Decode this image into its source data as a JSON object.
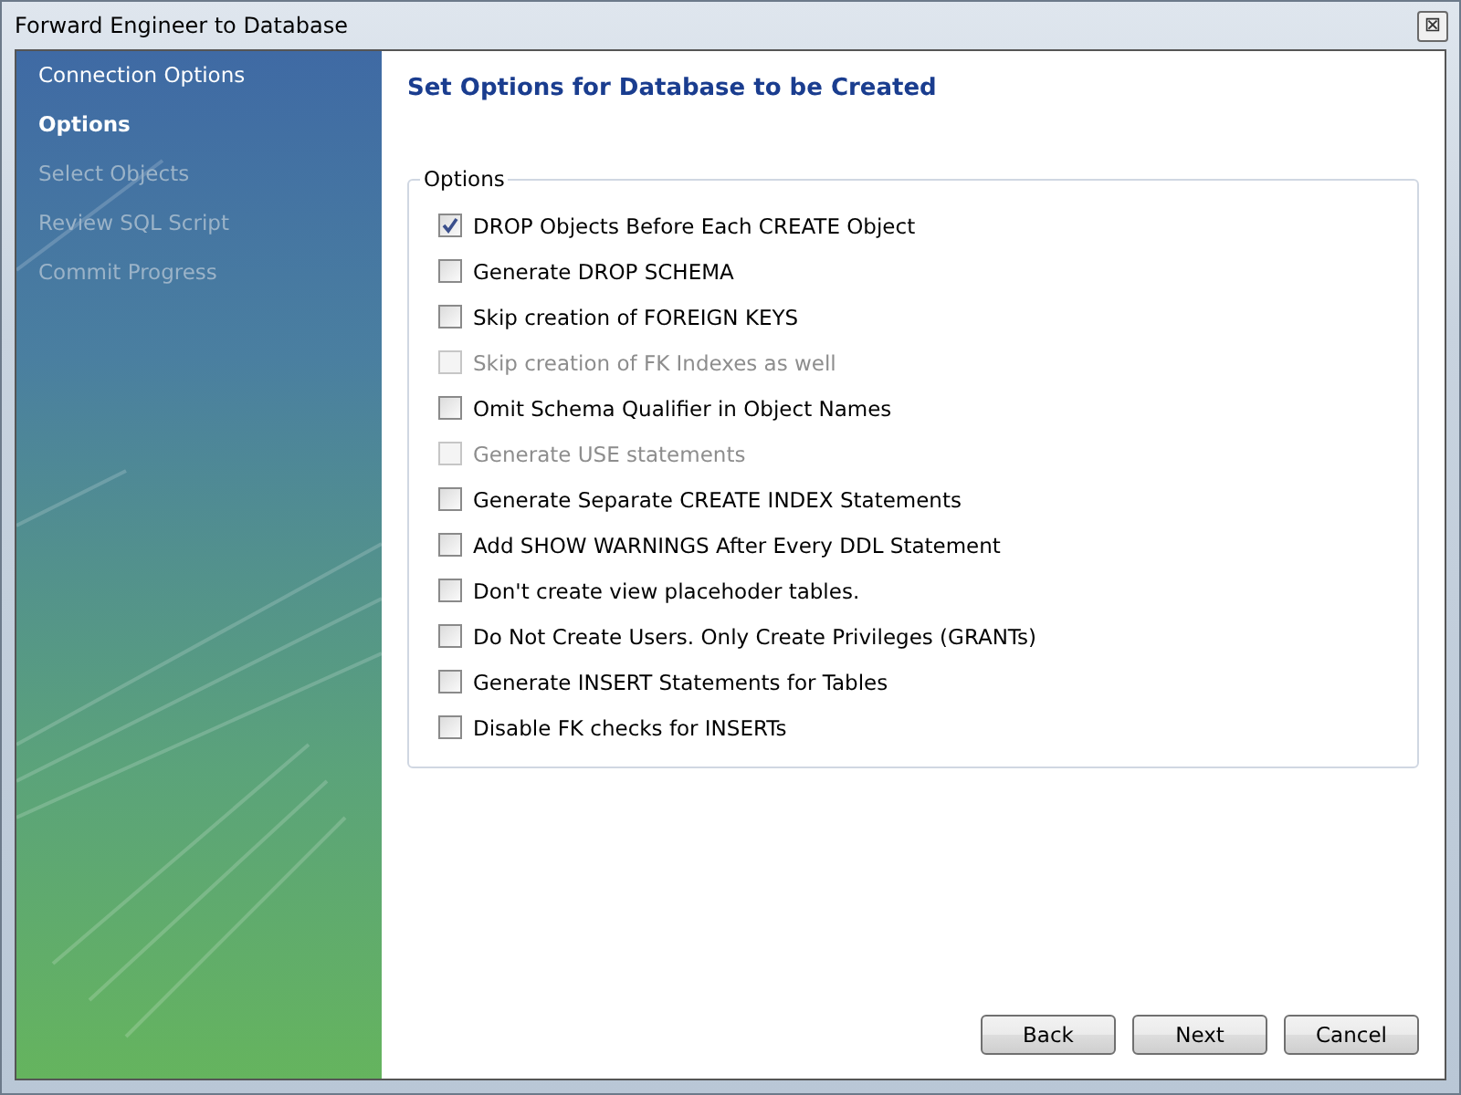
{
  "window": {
    "title": "Forward Engineer to Database",
    "close_icon": "⊠"
  },
  "sidebar": {
    "items": [
      {
        "label": "Connection Options",
        "selected": false,
        "disabled": false
      },
      {
        "label": "Options",
        "selected": true,
        "disabled": false
      },
      {
        "label": "Select Objects",
        "selected": false,
        "disabled": true
      },
      {
        "label": "Review SQL Script",
        "selected": false,
        "disabled": true
      },
      {
        "label": "Commit Progress",
        "selected": false,
        "disabled": true
      }
    ]
  },
  "heading": "Set Options for Database to be Created",
  "group": {
    "title": "Options",
    "options": [
      {
        "label": "DROP Objects Before Each CREATE Object",
        "checked": true,
        "disabled": false
      },
      {
        "label": "Generate DROP SCHEMA",
        "checked": false,
        "disabled": false
      },
      {
        "label": "Skip creation of FOREIGN KEYS",
        "checked": false,
        "disabled": false
      },
      {
        "label": "Skip creation of FK Indexes as well",
        "checked": false,
        "disabled": true
      },
      {
        "label": "Omit Schema Qualifier in Object Names",
        "checked": false,
        "disabled": false
      },
      {
        "label": "Generate USE statements",
        "checked": false,
        "disabled": true
      },
      {
        "label": "Generate Separate CREATE INDEX Statements",
        "checked": false,
        "disabled": false
      },
      {
        "label": "Add SHOW WARNINGS After Every DDL Statement",
        "checked": false,
        "disabled": false
      },
      {
        "label": "Don't create view placehoder tables.",
        "checked": false,
        "disabled": false
      },
      {
        "label": "Do Not Create Users. Only Create Privileges (GRANTs)",
        "checked": false,
        "disabled": false
      },
      {
        "label": "Generate INSERT Statements for Tables",
        "checked": false,
        "disabled": false
      },
      {
        "label": "Disable FK checks for INSERTs",
        "checked": false,
        "disabled": false
      }
    ]
  },
  "buttons": [
    "Back",
    "Next",
    "Cancel"
  ]
}
